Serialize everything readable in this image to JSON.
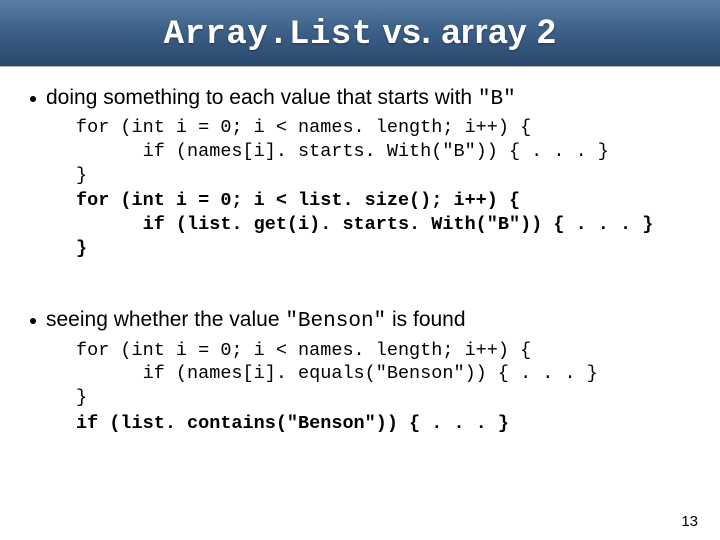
{
  "title": {
    "left_mono": "Array.List",
    "mid": " vs. array 2"
  },
  "bullets": [
    {
      "pre": "doing something to each value that starts with ",
      "mono": "\"B\""
    },
    {
      "pre": "seeing whether the value ",
      "mono": "\"Benson\"",
      "post": " is found"
    }
  ],
  "code": {
    "a1": "for (int i = 0; i < names. length; i++) {\n      if (names[i]. starts. With(\"B\")) { . . . }\n}",
    "a2": "for (int i = 0; i < list. size(); i++) {\n      if (list. get(i). starts. With(\"B\")) { . . . }\n}",
    "b1": "for (int i = 0; i < names. length; i++) {\n      if (names[i]. equals(\"Benson\")) { . . . }\n}",
    "b2": "if (list. contains(\"Benson\")) { . . . }"
  },
  "page_number": "13"
}
